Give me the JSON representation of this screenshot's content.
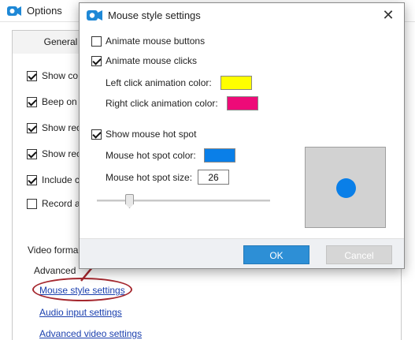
{
  "background_window": {
    "title": "Options",
    "tab_label": "General",
    "options": [
      {
        "label": "Show co",
        "checked": true
      },
      {
        "label": "Beep on",
        "checked": true
      },
      {
        "label": "Show rec",
        "checked": true
      },
      {
        "label": "Show rec",
        "checked": true
      },
      {
        "label": "Include c",
        "checked": true
      },
      {
        "label": "Record a",
        "checked": false
      }
    ],
    "video_format_label": "Video forma",
    "advanced_label": "Advanced",
    "links": {
      "mouse_style": "Mouse style settings",
      "audio_input": "Audio input settings",
      "advanced_video": "Advanced video settings"
    }
  },
  "dialog": {
    "title": "Mouse style settings",
    "close_glyph": "✕",
    "animate_buttons": {
      "label": "Animate mouse buttons",
      "checked": false
    },
    "animate_clicks": {
      "label": "Animate mouse clicks",
      "checked": true
    },
    "left_click_color_label": "Left click animation color:",
    "left_click_color": "#ffff00",
    "right_click_color_label": "Right click animation color:",
    "right_click_color": "#ee0a78",
    "show_hot_spot": {
      "label": "Show mouse hot spot",
      "checked": true
    },
    "hot_spot_color_label": "Mouse hot spot color:",
    "hot_spot_color": "#0a7fe8",
    "hot_spot_size_label": "Mouse hot spot size:",
    "hot_spot_size": "26",
    "preview_dot_color": "#0a7fe8",
    "ok_label": "OK",
    "cancel_label": "Cancel"
  },
  "colors": {
    "ok_button": "#2d8fd6",
    "annotation": "#a5272e"
  }
}
